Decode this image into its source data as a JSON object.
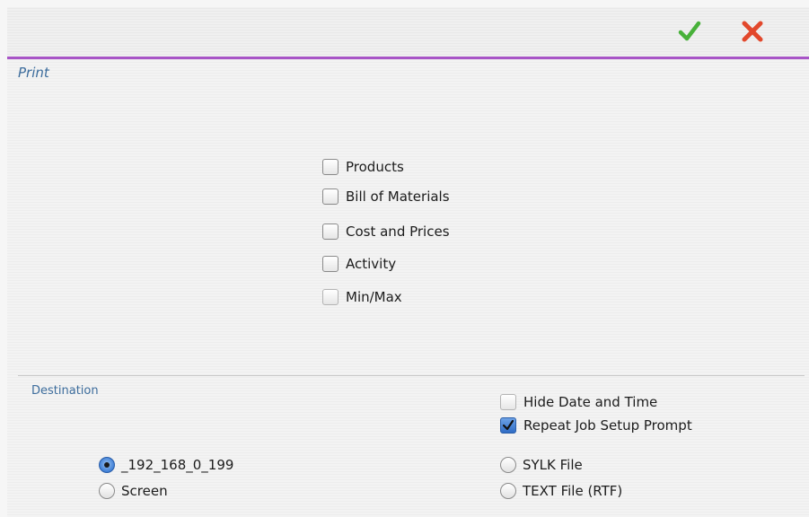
{
  "toolbar": {
    "ok_icon": "checkmark-icon",
    "cancel_icon": "x-close-icon",
    "ok_color": "#48b13a",
    "cancel_color": "#e2482c",
    "accent_color": "#a855c7"
  },
  "print": {
    "title": "Print",
    "options": [
      {
        "label": "Products",
        "checked": false
      },
      {
        "label": "Bill of Materials",
        "checked": false
      },
      {
        "label": "Cost and Prices",
        "checked": false
      },
      {
        "label": "Activity",
        "checked": false
      },
      {
        "label": "Min/Max",
        "checked": false
      }
    ]
  },
  "destination": {
    "title": "Destination",
    "hide_date_time": {
      "label": "Hide Date and Time",
      "checked": false
    },
    "repeat_job_setup": {
      "label": "Repeat Job Setup Prompt",
      "checked": true
    },
    "printers": [
      {
        "label": "_192_168_0_199",
        "selected": true
      },
      {
        "label": "Screen",
        "selected": false
      }
    ],
    "files": [
      {
        "label": "SYLK File",
        "selected": false
      },
      {
        "label": "TEXT File (RTF)",
        "selected": false
      }
    ]
  }
}
